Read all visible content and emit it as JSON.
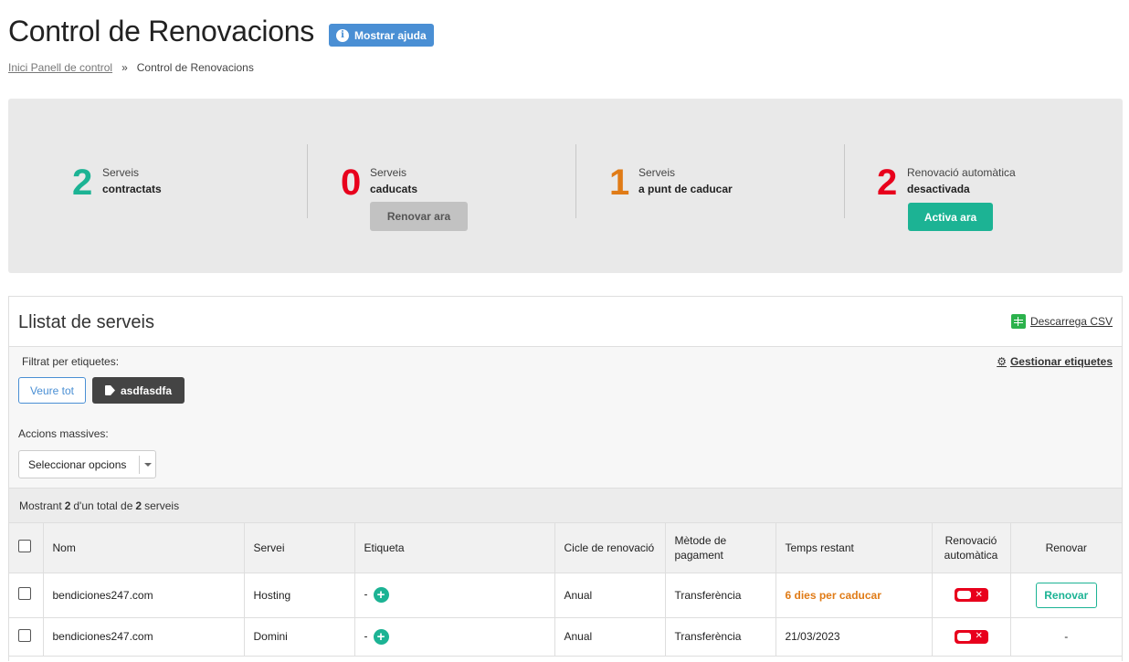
{
  "header": {
    "title": "Control de Renovacions",
    "help_label": "Mostrar ajuda"
  },
  "breadcrumb": {
    "home": "Inici Panell de control",
    "separator": "»",
    "current": "Control de Renovacions"
  },
  "stats": {
    "contracted": {
      "number": "2",
      "line1": "Serveis",
      "line2": "contractats",
      "color": "#1cb394"
    },
    "expired": {
      "number": "0",
      "line1": "Serveis",
      "line2": "caducats",
      "color": "#e8001c",
      "button": "Renovar ara"
    },
    "expiring": {
      "number": "1",
      "line1": "Serveis",
      "line2": "a punt de caducar",
      "color": "#e07b16"
    },
    "autorenew": {
      "number": "2",
      "line1": "Renovació automàtica",
      "line2": "desactivada",
      "color": "#e8001c",
      "button": "Activa ara"
    }
  },
  "list": {
    "title": "Llistat de serveis",
    "csv_label": "Descarrega CSV",
    "filter_label": "Filtrat per etiquetes:",
    "manage_tags": "Gestionar etiquetes",
    "see_all": "Veure tot",
    "tag": "asdfasdfa",
    "mass_actions_label": "Accions massives:",
    "mass_actions_value": "Seleccionar opcions",
    "showing_prefix": "Mostrant",
    "showing_count": "2",
    "showing_mid": "d'un total de",
    "showing_total": "2",
    "showing_suffix": "serveis"
  },
  "table": {
    "headers": {
      "name": "Nom",
      "service": "Servei",
      "tag": "Etiqueta",
      "cycle": "Cicle de renovació",
      "payment": "Mètode de pagament",
      "remaining": "Temps restant",
      "autorenew": "Renovació automàtica",
      "renew": "Renovar"
    },
    "rows": [
      {
        "name": "bendiciones247.com",
        "service": "Hosting",
        "tag": "-",
        "cycle": "Anual",
        "payment": "Transferència",
        "remaining": "6 dies per caducar",
        "renew": "Renovar"
      },
      {
        "name": "bendiciones247.com",
        "service": "Domini",
        "tag": "-",
        "cycle": "Anual",
        "payment": "Transferència",
        "remaining": "21/03/2023",
        "renew": "-"
      }
    ]
  }
}
